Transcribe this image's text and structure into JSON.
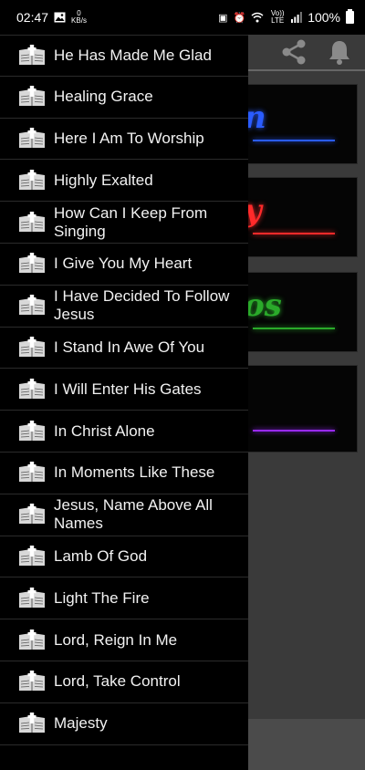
{
  "status_bar": {
    "time": "02:47",
    "net_speed_value": "0",
    "net_speed_unit": "KB/s",
    "volte_label": "Vo)) LTE",
    "battery": "100%"
  },
  "toolbar": {
    "share_icon": "share-icon",
    "notification_icon": "bell-icon"
  },
  "cards": [
    {
      "text": "n",
      "color": "#2a5cff"
    },
    {
      "text": "y",
      "color": "#ff2a2a"
    },
    {
      "text": "os",
      "color": "#2aaa2a"
    },
    {
      "text": "",
      "color": "#9a2aff"
    }
  ],
  "drawer": {
    "item_icon": "bible-icon",
    "items": [
      {
        "label": "He Has Made Me Glad"
      },
      {
        "label": "Healing Grace"
      },
      {
        "label": "Here I Am To Worship"
      },
      {
        "label": "Highly Exalted"
      },
      {
        "label": "How Can I Keep From Singing"
      },
      {
        "label": "I Give You My Heart"
      },
      {
        "label": "I Have Decided To Follow Jesus"
      },
      {
        "label": "I Stand In Awe Of You"
      },
      {
        "label": "I Will Enter His Gates"
      },
      {
        "label": "In Christ Alone"
      },
      {
        "label": "In Moments Like These"
      },
      {
        "label": "Jesus, Name Above All Names"
      },
      {
        "label": "Lamb Of God"
      },
      {
        "label": "Light The Fire"
      },
      {
        "label": "Lord, Reign In Me"
      },
      {
        "label": "Lord, Take Control"
      },
      {
        "label": "Majesty"
      }
    ]
  }
}
